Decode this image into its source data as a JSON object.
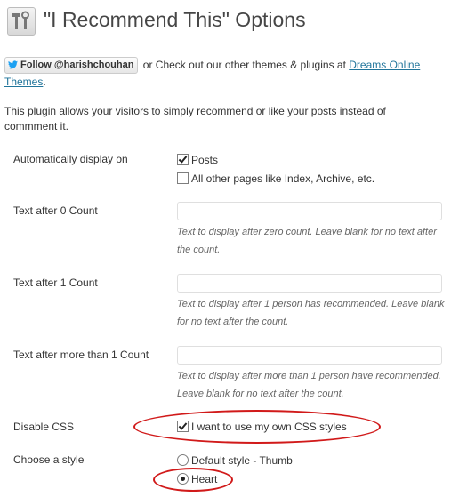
{
  "header": {
    "title": "\"I Recommend This\" Options"
  },
  "intro": {
    "follow_button": "Follow @harishchouhan",
    "text_before": " or Check out our other themes & plugins at ",
    "link_text": "Dreams Online Themes",
    "text_after": "."
  },
  "description": "This plugin allows your visitors to simply recommend or like your posts instead of commment it.",
  "settings": {
    "display_on": {
      "label": "Automatically display on",
      "options": [
        {
          "label": "Posts",
          "checked": true
        },
        {
          "label": "All other pages like Index, Archive, etc.",
          "checked": false
        }
      ]
    },
    "text_zero": {
      "label": "Text after 0 Count",
      "value": "",
      "help": "Text to display after zero count. Leave blank for no text after the count."
    },
    "text_one": {
      "label": "Text after 1 Count",
      "value": "",
      "help": "Text to display after 1 person has recommended. Leave blank for no text after the count."
    },
    "text_more": {
      "label": "Text after more than 1 Count",
      "value": "",
      "help": "Text to display after more than 1 person have recommended. Leave blank for no text after the count."
    },
    "disable_css": {
      "label": "Disable CSS",
      "option": "I want to use my own CSS styles",
      "checked": true
    },
    "style": {
      "label": "Choose a style",
      "options": [
        {
          "label": "Default style - Thumb",
          "checked": false
        },
        {
          "label": "Heart",
          "checked": true
        }
      ]
    }
  },
  "colors": {
    "annotation": "#d11a1a",
    "link": "#21759b",
    "twitter": "#1da1f2"
  }
}
